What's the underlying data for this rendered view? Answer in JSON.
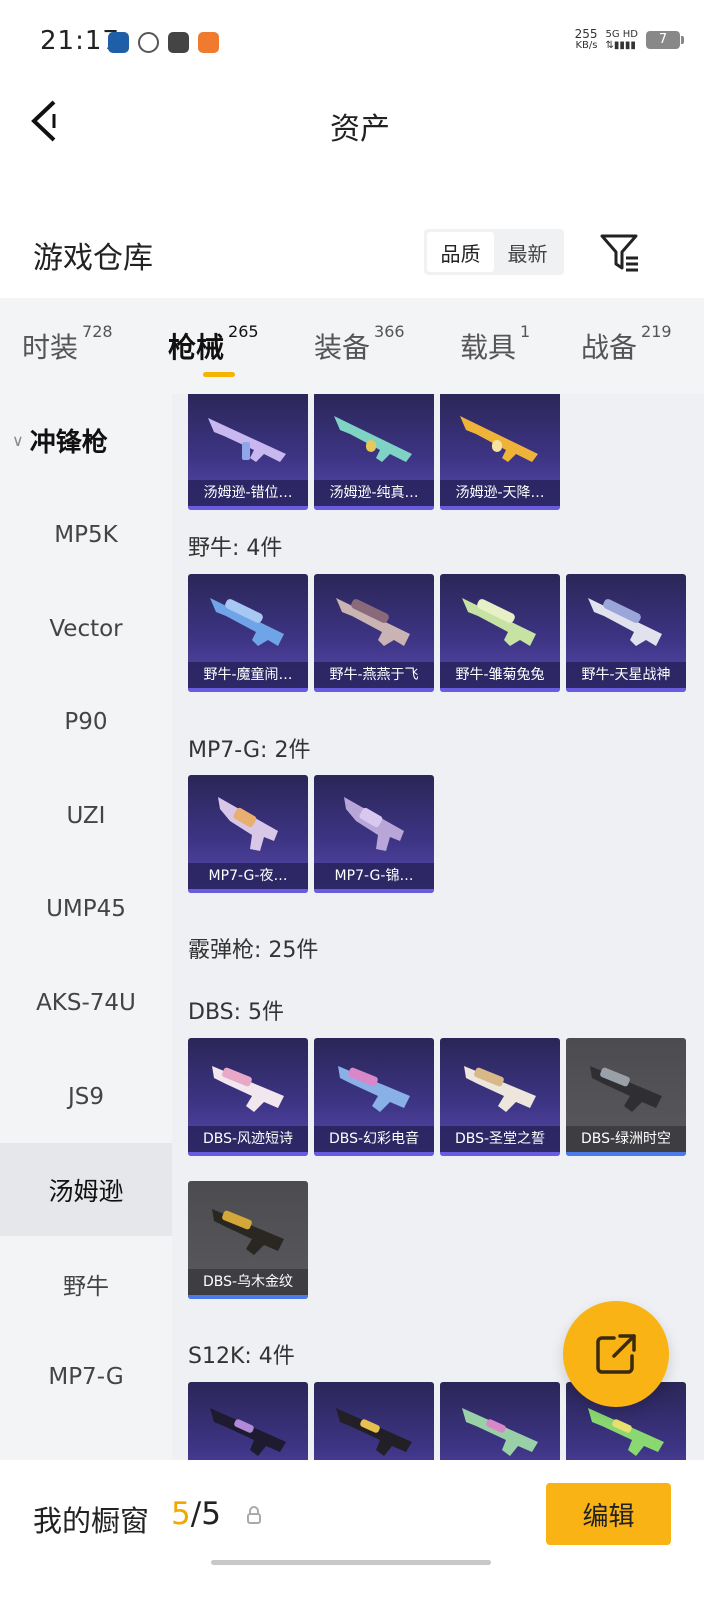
{
  "status_bar": {
    "time": "21:17",
    "net_speed_value": "255",
    "net_speed_unit": "KB/s",
    "network": "5G HD",
    "battery": "7",
    "apps": [
      "app-icon-1",
      "browser-icon",
      "mail-icon",
      "store-icon"
    ]
  },
  "header": {
    "title": "资产",
    "back_icon": "chevron-left-icon"
  },
  "warehouse": {
    "title": "游戏仓库",
    "sort_options": [
      "品质",
      "最新"
    ],
    "sort_active": "品质",
    "filter_icon": "filter-icon"
  },
  "tabs": [
    {
      "label": "时装",
      "count": "728"
    },
    {
      "label": "枪械",
      "count": "265"
    },
    {
      "label": "装备",
      "count": "366"
    },
    {
      "label": "载具",
      "count": "1"
    },
    {
      "label": "战备",
      "count": "219"
    }
  ],
  "tabs_active": "枪械",
  "sidebar": {
    "group": "冲锋枪",
    "items": [
      "MP5K",
      "Vector",
      "P90",
      "UZI",
      "UMP45",
      "AKS-74U",
      "JS9",
      "汤姆逊",
      "野牛",
      "MP7-G"
    ],
    "active": "汤姆逊"
  },
  "content": {
    "row_tommy": [
      "汤姆逊-错位…",
      "汤姆逊-纯真…",
      "汤姆逊-天降…"
    ],
    "sections": [
      {
        "label": "野牛: 4件",
        "items": [
          "野牛-魔童闹…",
          "野牛-燕燕于飞",
          "野牛-雏菊兔兔",
          "野牛-天星战神"
        ]
      },
      {
        "label": "MP7-G: 2件",
        "items": [
          "MP7-G-夜…",
          "MP7-G-锦…"
        ]
      },
      {
        "label": "霰弹枪: 25件",
        "items": []
      },
      {
        "label": "DBS: 5件",
        "items": [
          "DBS-风迹短诗",
          "DBS-幻彩电音",
          "DBS-圣堂之誓",
          "DBS-绿洲时空",
          "DBS-乌木金纹"
        ]
      },
      {
        "label": "S12K: 4件",
        "items": []
      }
    ]
  },
  "share_icon": "share-external-icon",
  "bottom": {
    "showcase_label": "我的橱窗",
    "showcase_current": "5",
    "showcase_sep": "/",
    "showcase_total": "5",
    "lock_icon": "lock-icon",
    "edit_label": "编辑"
  },
  "colors": {
    "accent": "#f9b314",
    "card_purple": "#3d3484",
    "card_gray": "#55555a"
  }
}
